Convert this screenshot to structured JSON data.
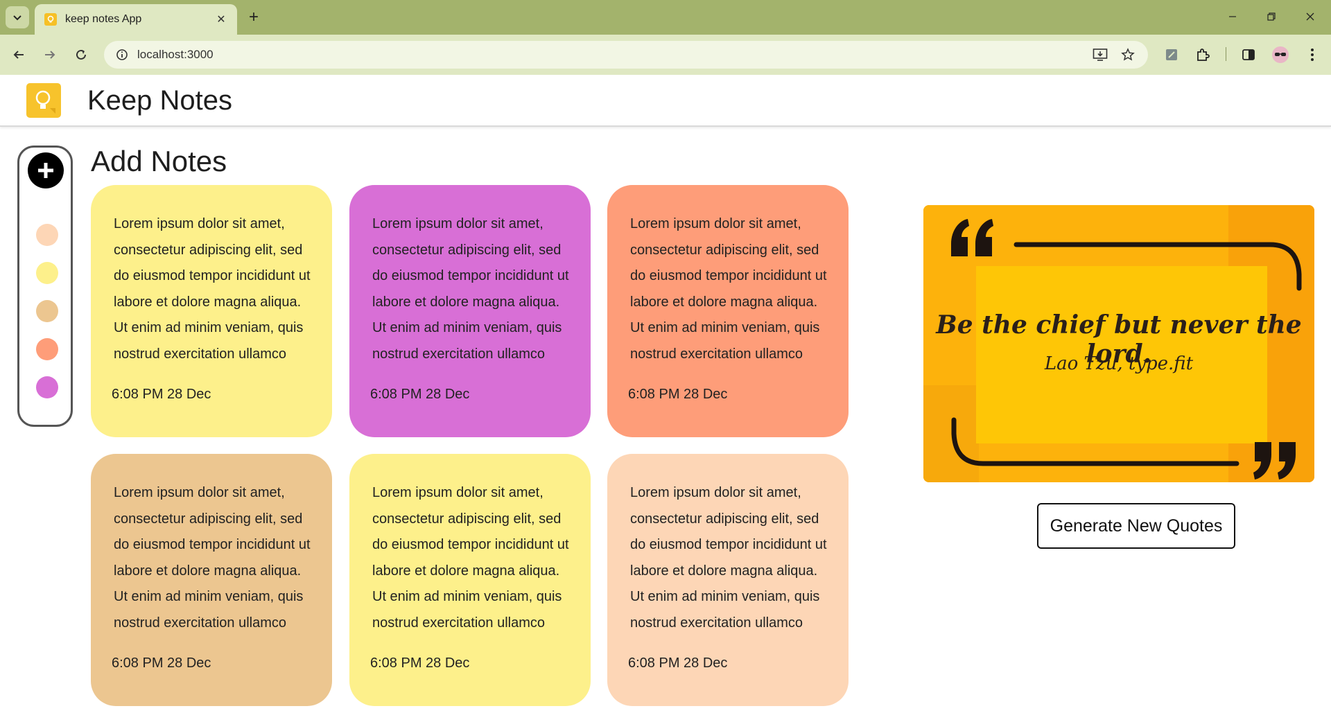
{
  "browser": {
    "tab_title": "keep notes App",
    "url": "localhost:3000"
  },
  "header": {
    "title": "Keep Notes"
  },
  "sidebar": {
    "swatches": [
      "#fdd6b6",
      "#fdf08b",
      "#ecc690",
      "#fe9d79",
      "#d86fd6"
    ]
  },
  "main": {
    "section_title": "Add Notes"
  },
  "notes": [
    {
      "text": "Lorem ipsum dolor sit amet, consectetur adipiscing elit, sed do eiusmod tempor incididunt ut labore et dolore magna aliqua. Ut enim ad minim veniam, quis nostrud exercitation ullamco laboris nisi",
      "date": "6:08 PM 28 Dec",
      "color": "#fdf08b"
    },
    {
      "text": "Lorem ipsum dolor sit amet, consectetur adipiscing elit, sed do eiusmod tempor incididunt ut labore et dolore magna aliqua. Ut enim ad minim veniam, quis nostrud exercitation ullamco laboris nisi",
      "date": "6:08 PM 28 Dec",
      "color": "#d86fd6"
    },
    {
      "text": "Lorem ipsum dolor sit amet, consectetur adipiscing elit, sed do eiusmod tempor incididunt ut labore et dolore magna aliqua. Ut enim ad minim veniam, quis nostrud exercitation ullamco laboris nisi",
      "date": "6:08 PM 28 Dec",
      "color": "#fe9d79"
    },
    {
      "text": "Lorem ipsum dolor sit amet, consectetur adipiscing elit, sed do eiusmod tempor incididunt ut labore et dolore magna aliqua. Ut enim ad minim veniam, quis nostrud exercitation ullamco laboris nisi",
      "date": "6:08 PM 28 Dec",
      "color": "#ecc690"
    },
    {
      "text": "Lorem ipsum dolor sit amet, consectetur adipiscing elit, sed do eiusmod tempor incididunt ut labore et dolore magna aliqua. Ut enim ad minim veniam, quis nostrud exercitation ullamco laboris nisi",
      "date": "6:08 PM 28 Dec",
      "color": "#fdf08b"
    },
    {
      "text": "Lorem ipsum dolor sit amet, consectetur adipiscing elit, sed do eiusmod tempor incididunt ut labore et dolore magna aliqua. Ut enim ad minim veniam, quis nostrud exercitation ullamco laboris nisi",
      "date": "6:08 PM 28 Dec",
      "color": "#fdd6b6"
    }
  ],
  "quote": {
    "text": "Be the chief but never the lord.",
    "author": "Lao Tzu, type.fit"
  },
  "generate_button_label": "Generate New Quotes",
  "icons": {
    "tab_search": "chevron-down-icon",
    "favicon": "lightbulb-icon",
    "close": "close-icon",
    "new_tab": "plus-icon",
    "back": "arrow-left-icon",
    "forward": "arrow-right-icon",
    "reload": "reload-icon",
    "site_info": "info-icon",
    "install": "install-icon",
    "bookmark": "star-icon",
    "extension_1": "extension-icon",
    "extensions": "puzzle-icon",
    "side_panel": "side-panel-icon",
    "profile": "avatar",
    "menu": "kebab-menu-icon",
    "add_note": "plus-circle-icon"
  }
}
